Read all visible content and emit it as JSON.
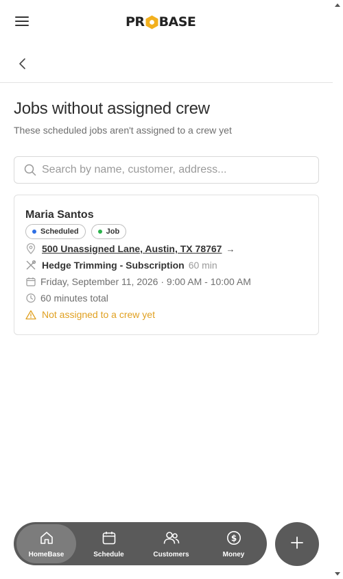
{
  "header": {
    "logo_text_left": "PR",
    "logo_text_right": "BASE"
  },
  "page": {
    "title": "Jobs without assigned crew",
    "subtitle": "These scheduled jobs aren't assigned to a crew yet"
  },
  "search": {
    "placeholder": "Search by name, customer, address...",
    "value": ""
  },
  "jobs": [
    {
      "customer": "Maria Santos",
      "badges": [
        {
          "label": "Scheduled",
          "dot_color": "#2f6fe4"
        },
        {
          "label": "Job",
          "dot_color": "#2bb24c"
        }
      ],
      "address": "500 Unassigned Lane, Austin, TX 78767",
      "address_arrow": "→",
      "service": "Hedge Trimming - Subscription",
      "service_duration": "60 min",
      "date_time": "Friday, September 11, 2026 · 9:00 AM - 10:00 AM",
      "total": "60 minutes total",
      "warning": "Not assigned to a crew yet"
    }
  ],
  "bottom_nav": {
    "items": [
      {
        "label": "HomeBase",
        "icon": "home-icon",
        "active": true
      },
      {
        "label": "Schedule",
        "icon": "calendar-icon",
        "active": false
      },
      {
        "label": "Customers",
        "icon": "users-icon",
        "active": false
      },
      {
        "label": "Money",
        "icon": "dollar-icon",
        "active": false
      }
    ],
    "fab_icon": "plus-icon"
  },
  "colors": {
    "accent_warning": "#e0a020",
    "nav_bg": "#5a5a5a",
    "logo_accent": "#f2b01e"
  }
}
